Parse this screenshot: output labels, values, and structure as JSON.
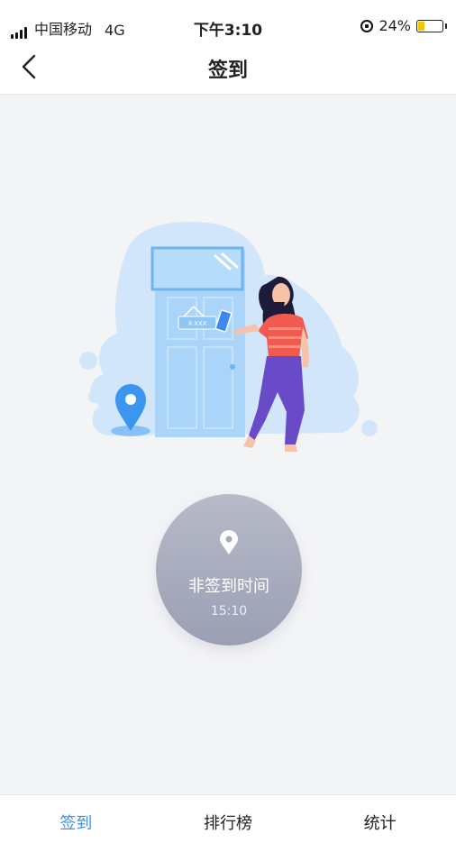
{
  "status_bar": {
    "carrier": "中国移动",
    "network": "4G",
    "time": "下午3:10",
    "battery_percent": "24%",
    "battery_level": 0.24,
    "icons": [
      "signal-icon",
      "orientation-lock-icon",
      "battery-icon"
    ]
  },
  "nav": {
    "title": "签到",
    "back_icon": "chevron-left-icon"
  },
  "illustration": {
    "sign_text": "X-XXX"
  },
  "checkin": {
    "status_text": "非签到时间",
    "time": "15:10",
    "icon": "location-pin-icon",
    "color": "#a6aabb"
  },
  "tabs": [
    {
      "label": "签到",
      "active": true
    },
    {
      "label": "排行榜",
      "active": false
    },
    {
      "label": "统计",
      "active": false
    }
  ],
  "colors": {
    "accent": "#3a8ee6",
    "background": "#f3f4f6"
  }
}
